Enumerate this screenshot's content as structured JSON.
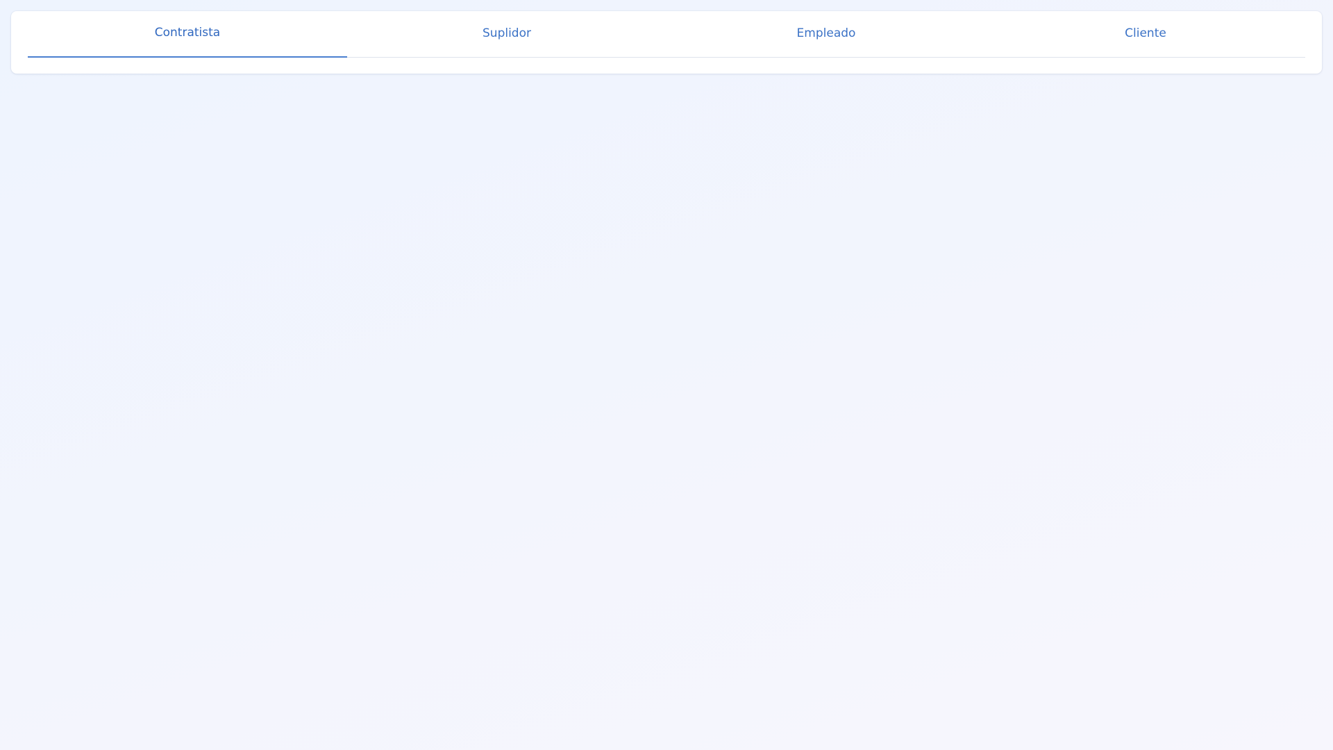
{
  "tabs": {
    "active_index": 0,
    "items": [
      {
        "label": "Contratista"
      },
      {
        "label": "Suplidor"
      },
      {
        "label": "Empleado"
      },
      {
        "label": "Cliente"
      }
    ]
  },
  "colors": {
    "accent": "#4a7fd0",
    "tab_text": "#3b72c6",
    "divider": "#dde3ec",
    "card_background": "#ffffff",
    "page_background": "#eef4fe"
  }
}
